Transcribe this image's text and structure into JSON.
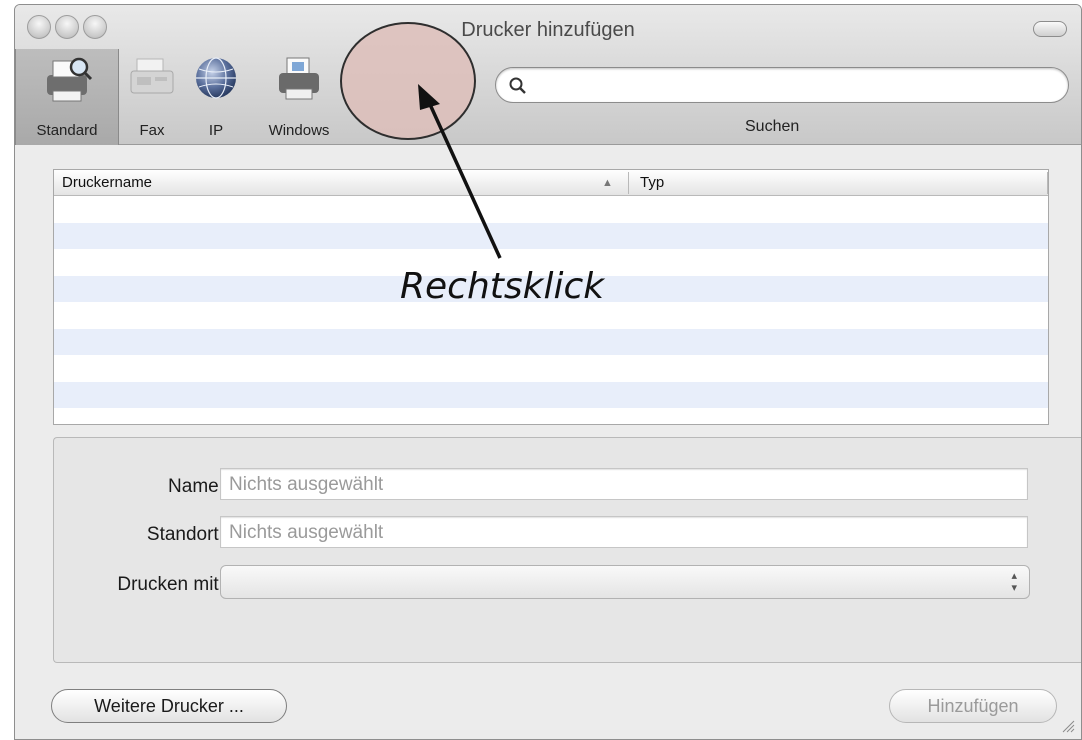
{
  "window": {
    "title": "Drucker hinzufügen"
  },
  "toolbar": {
    "items": [
      {
        "label": "Standard",
        "icon": "default-printer-icon",
        "selected": true
      },
      {
        "label": "Fax",
        "icon": "fax-icon",
        "selected": false
      },
      {
        "label": "IP",
        "icon": "globe-icon",
        "selected": false
      },
      {
        "label": "Windows",
        "icon": "windows-printer-icon",
        "selected": false
      }
    ],
    "search": {
      "label": "Suchen",
      "value": "",
      "placeholder": ""
    }
  },
  "printer_table": {
    "columns": [
      "Druckername",
      "Typ"
    ],
    "sort_indicator": "▲",
    "rows": []
  },
  "annotation": {
    "text": "Rechtsklick"
  },
  "details": {
    "name_label": "Name:",
    "name_value": "Nichts ausgewählt",
    "location_label": "Standort:",
    "location_value": "Nichts ausgewählt",
    "print_with_label": "Drucken mit:",
    "print_with_value": ""
  },
  "buttons": {
    "more_printers": "Weitere Drucker ...",
    "add": "Hinzufügen"
  },
  "colors": {
    "row_alternate": "#e8eefa",
    "annotation_fill": "#ddbebA"
  }
}
